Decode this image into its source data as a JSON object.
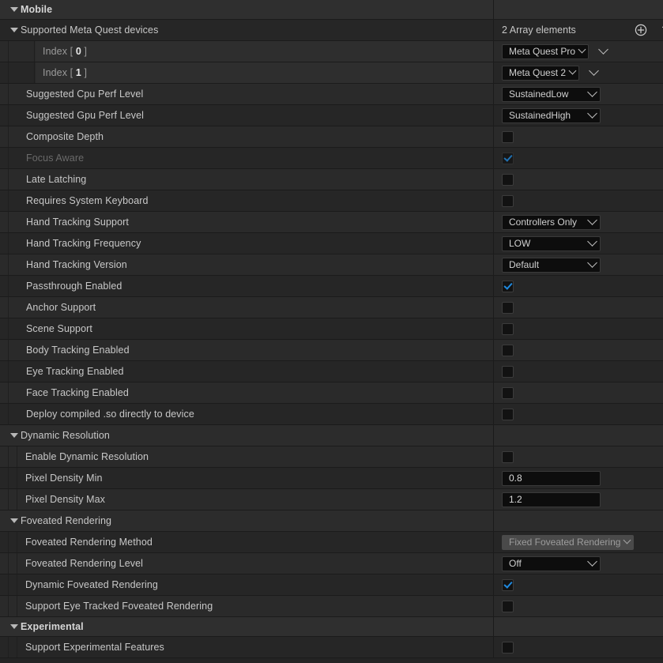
{
  "panel": {
    "title": "Mobile",
    "array_elements_text": "2 Array elements",
    "add_icon": "plus-circle-icon",
    "delete_icon": "trash-icon"
  },
  "sections": [
    {
      "id": "mobile",
      "label": "Mobile",
      "type": "category",
      "bold": true,
      "expanded": true
    },
    {
      "id": "supported_devices",
      "label": "Supported Meta Quest devices",
      "type": "array-header",
      "expanded": true,
      "value_text": "2 Array elements"
    }
  ],
  "array_elements": [
    {
      "index_label": "Index [ 0 ]",
      "index": "0",
      "value": "Meta Quest Pro"
    },
    {
      "index_label": "Index [ 1 ]",
      "index": "1",
      "value": "Meta Quest 2"
    }
  ],
  "rows": [
    {
      "label": "Suggested Cpu Perf Level",
      "control": "combo",
      "value": "SustainedLow",
      "width": "w125",
      "indent": 1,
      "disabled": false
    },
    {
      "label": "Suggested Gpu Perf Level",
      "control": "combo",
      "value": "SustainedHigh",
      "width": "w125",
      "indent": 1,
      "disabled": false
    },
    {
      "label": "Composite Depth",
      "control": "checkbox",
      "checked": false,
      "indent": 1,
      "disabled": false
    },
    {
      "label": "Focus Aware",
      "control": "checkbox",
      "checked": true,
      "indent": 1,
      "disabled": true
    },
    {
      "label": "Late Latching",
      "control": "checkbox",
      "checked": false,
      "indent": 1,
      "disabled": false
    },
    {
      "label": "Requires System Keyboard",
      "control": "checkbox",
      "checked": false,
      "indent": 1,
      "disabled": false
    },
    {
      "label": "Hand Tracking Support",
      "control": "combo",
      "value": "Controllers Only",
      "width": "w125",
      "indent": 1,
      "disabled": false
    },
    {
      "label": "Hand Tracking Frequency",
      "control": "combo",
      "value": "LOW",
      "width": "w125",
      "indent": 1,
      "disabled": false
    },
    {
      "label": "Hand Tracking Version",
      "control": "combo",
      "value": "Default",
      "width": "w125",
      "indent": 1,
      "disabled": false
    },
    {
      "label": "Passthrough Enabled",
      "control": "checkbox",
      "checked": true,
      "indent": 1,
      "disabled": false
    },
    {
      "label": "Anchor Support",
      "control": "checkbox",
      "checked": false,
      "indent": 1,
      "disabled": false
    },
    {
      "label": "Scene Support",
      "control": "checkbox",
      "checked": false,
      "indent": 1,
      "disabled": false
    },
    {
      "label": "Body Tracking Enabled",
      "control": "checkbox",
      "checked": false,
      "indent": 1,
      "disabled": false
    },
    {
      "label": "Eye Tracking Enabled",
      "control": "checkbox",
      "checked": false,
      "indent": 1,
      "disabled": false
    },
    {
      "label": "Face Tracking Enabled",
      "control": "checkbox",
      "checked": false,
      "indent": 1,
      "disabled": false
    },
    {
      "label": "Deploy compiled .so directly to device",
      "control": "checkbox",
      "checked": false,
      "indent": 1,
      "disabled": false
    },
    {
      "label": "Dynamic Resolution",
      "control": "none",
      "type": "group",
      "indent": 0,
      "expanded": true
    },
    {
      "label": "Enable Dynamic Resolution",
      "control": "checkbox",
      "checked": false,
      "indent": 2,
      "disabled": false
    },
    {
      "label": "Pixel Density Min",
      "control": "number",
      "value": "0.8",
      "indent": 2,
      "disabled": false
    },
    {
      "label": "Pixel Density Max",
      "control": "number",
      "value": "1.2",
      "indent": 2,
      "disabled": false
    },
    {
      "label": "Foveated Rendering",
      "control": "none",
      "type": "group",
      "indent": 0,
      "expanded": true
    },
    {
      "label": "Foveated Rendering Method",
      "control": "combo",
      "value": "Fixed Foveated Rendering",
      "width": "auto",
      "indent": 2,
      "disabled": true
    },
    {
      "label": "Foveated Rendering Level",
      "control": "combo",
      "value": "Off",
      "width": "w125",
      "indent": 2,
      "disabled": false
    },
    {
      "label": "Dynamic Foveated Rendering",
      "control": "checkbox",
      "checked": true,
      "indent": 2,
      "disabled": false
    },
    {
      "label": "Support Eye Tracked Foveated Rendering",
      "control": "checkbox",
      "checked": false,
      "indent": 2,
      "disabled": false
    },
    {
      "label": "Experimental",
      "control": "none",
      "type": "category",
      "bold": true,
      "indent": 0,
      "expanded": true
    },
    {
      "label": "Support Experimental Features",
      "control": "checkbox",
      "checked": false,
      "indent": 2,
      "disabled": false
    }
  ],
  "colors": {
    "background": "#242424",
    "row": "#262626",
    "row_alt": "#2a2a2a",
    "category_header": "#2f2f2f",
    "accent_check": "#1f8ae0",
    "text": "#c8c8c8",
    "text_dim": "#6a6a6a",
    "control_bg": "#0d0d0d",
    "control_disabled_bg": "#4a4a4a"
  }
}
